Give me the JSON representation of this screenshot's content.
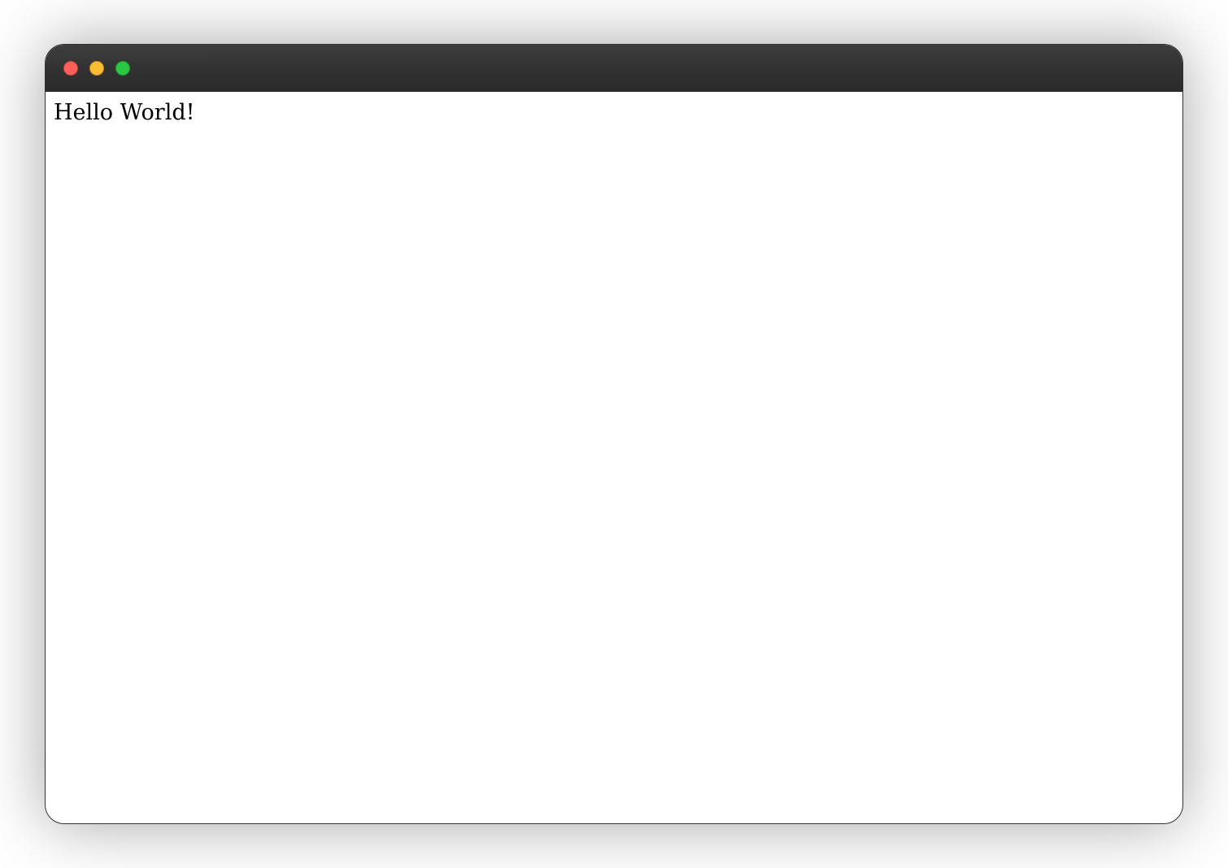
{
  "window": {
    "traffic_lights": {
      "close_color": "#ff5f57",
      "minimize_color": "#febc2e",
      "maximize_color": "#28c840"
    }
  },
  "content": {
    "text": "Hello World!"
  }
}
